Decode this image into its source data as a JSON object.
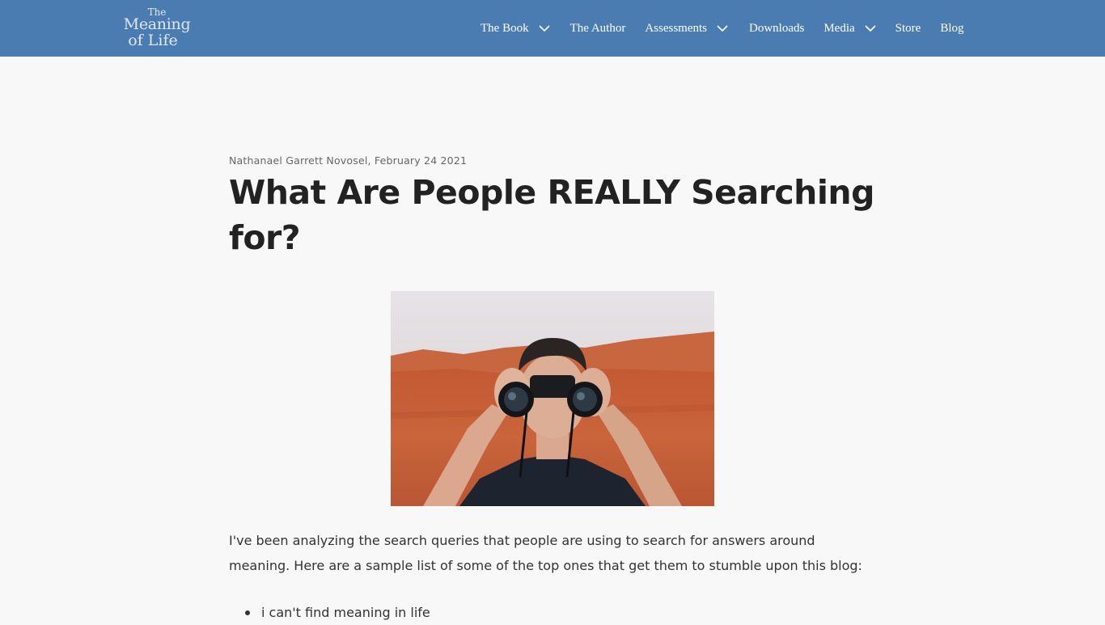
{
  "header": {
    "logo": {
      "line1": "The",
      "line2": "Meaning",
      "line3": "of Life"
    },
    "nav": [
      {
        "label": "The Book",
        "has_dropdown": true
      },
      {
        "label": "The Author",
        "has_dropdown": false
      },
      {
        "label": "Assessments",
        "has_dropdown": true
      },
      {
        "label": "Downloads",
        "has_dropdown": false
      },
      {
        "label": "Media",
        "has_dropdown": true
      },
      {
        "label": "Store",
        "has_dropdown": false
      },
      {
        "label": "Blog",
        "has_dropdown": false
      }
    ]
  },
  "colors": {
    "nav_background": "#4a7cb2",
    "page_background": "#f8f8f8",
    "title_text": "#222222",
    "byline_text": "#666666"
  },
  "post": {
    "byline": "Nathanael Garrett Novosel, February 24 2021",
    "title": "What Are People REALLY Searching for?",
    "intro": "I've been analyzing the search queries that people are using to search for answers around meaning.  Here are a sample list of some of the top ones that get them to stumble upon this blog:",
    "list_items": [
      "i can't find meaning in life"
    ]
  }
}
